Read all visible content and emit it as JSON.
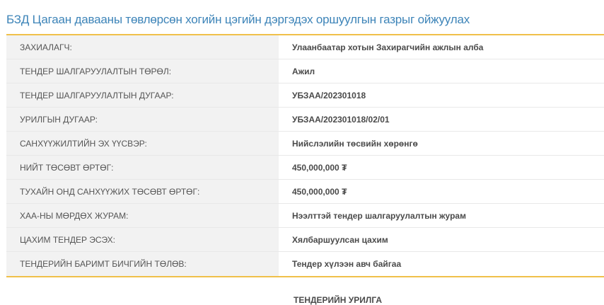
{
  "page": {
    "title": "БЗД Цагаан давааны төвлөрсөн хогийн цэгийн дэргэдэх оршуулгын газрыг ойжуулах",
    "section_heading": "ТЕНДЕРИЙН УРИЛГА"
  },
  "colors": {
    "title": "#3d84b8",
    "border_accent": "#f0c04a",
    "label_bg": "#f2f2f2"
  },
  "details": [
    {
      "label": "ЗАХИАЛАГЧ:",
      "value": "Улаанбаатар хотын Захирагчийн ажлын алба"
    },
    {
      "label": "ТЕНДЕР ШАЛГАРУУЛАЛТЫН ТӨРӨЛ:",
      "value": "Ажил"
    },
    {
      "label": "ТЕНДЕР ШАЛГАРУУЛАЛТЫН ДУГААР:",
      "value": "УБЗАА/202301018"
    },
    {
      "label": "УРИЛГЫН ДУГААР:",
      "value": "УБЗАА/202301018/02/01"
    },
    {
      "label": "САНХҮҮЖИЛТИЙН ЭХ ҮҮСВЭР:",
      "value": "Нийслэлийн төсвийн хөрөнгө"
    },
    {
      "label": "НИЙТ ТӨСӨВТ ӨРТӨГ:",
      "value": "450,000,000 ₮"
    },
    {
      "label": "ТУХАЙН ОНД САНХҮҮЖИХ ТӨСӨВТ ӨРТӨГ:",
      "value": "450,000,000 ₮"
    },
    {
      "label": "ХАА-НЫ МӨРДӨХ ЖУРАМ:",
      "value": "Нээлттэй тендер шалгаруулалтын журам"
    },
    {
      "label": "ЦАХИМ ТЕНДЕР ЭСЭХ:",
      "value": "Хялбаршуулсан цахим"
    },
    {
      "label": "ТЕНДЕРИЙН БАРИМТ БИЧГИЙН ТӨЛӨВ:",
      "value": "Тендер хүлээн авч байгаа"
    }
  ]
}
